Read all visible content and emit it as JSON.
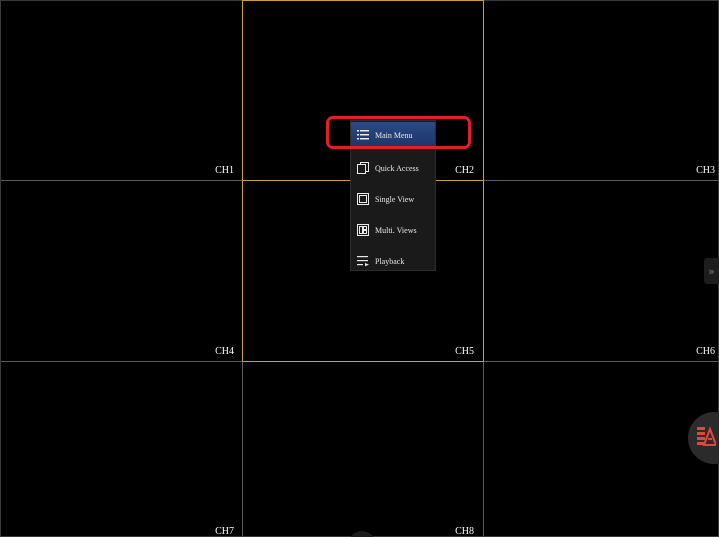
{
  "channels": [
    {
      "label": "CH1"
    },
    {
      "label": "CH2"
    },
    {
      "label": "CH3"
    },
    {
      "label": "CH4"
    },
    {
      "label": "CH5"
    },
    {
      "label": "CH6"
    },
    {
      "label": "CH7"
    },
    {
      "label": "CH8"
    }
  ],
  "context_menu": {
    "items": [
      {
        "label": "Main Menu",
        "icon": "list-icon",
        "active": true
      },
      {
        "label": "Quick Access",
        "icon": "copy-icon"
      },
      {
        "label": "Single View",
        "icon": "single-view-icon"
      },
      {
        "label": "Multi. Views",
        "icon": "multi-view-icon"
      },
      {
        "label": "Playback",
        "icon": "playback-icon"
      }
    ]
  },
  "colors": {
    "background": "#000000",
    "grid_line": "#5a5a5a",
    "selection": "#c9a227",
    "menu_active": "#2c4a86",
    "highlight": "#e41e26",
    "float_icon": "#e0483e"
  },
  "edge_tab": {
    "glyph": "»"
  }
}
